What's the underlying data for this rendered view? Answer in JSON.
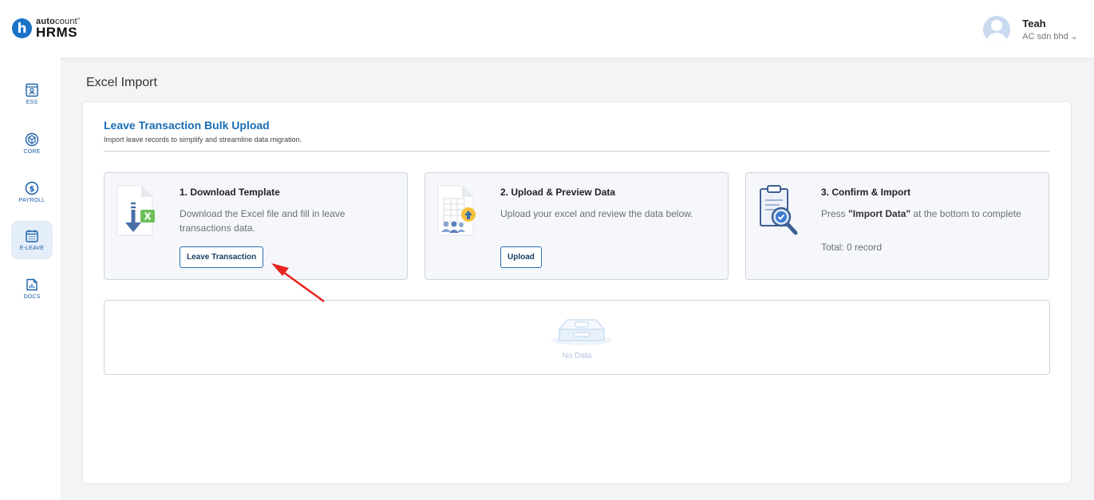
{
  "brand": {
    "initial": "h",
    "top_bold": "auto",
    "top_rest": "count",
    "mark": "°",
    "bottom": "HRMS"
  },
  "user": {
    "name": "Teah",
    "company": "AC sdn bhd",
    "chevron": "⌄"
  },
  "sidebar": {
    "items": [
      {
        "label": "ESS",
        "icon": "ess-icon",
        "active": false
      },
      {
        "label": "CORE",
        "icon": "core-icon",
        "active": false
      },
      {
        "label": "PAYROLL",
        "icon": "payroll-icon",
        "active": false
      },
      {
        "label": "E-LEAVE",
        "icon": "calendar-icon",
        "active": true
      },
      {
        "label": "DOCS",
        "icon": "docs-icon",
        "active": false
      }
    ]
  },
  "page": {
    "title": "Excel Import"
  },
  "section": {
    "title": "Leave Transaction Bulk Upload",
    "subtitle": "Import leave records to simplify and streamline data migration."
  },
  "steps": [
    {
      "title": "1. Download Template",
      "description": "Download the Excel file and fill in leave transactions data.",
      "button": "Leave Transaction",
      "icon": "excel-download-icon"
    },
    {
      "title": "2. Upload & Preview Data",
      "description": "Upload your excel and review the data below.",
      "button": "Upload",
      "icon": "upload-file-icon"
    },
    {
      "title": "3. Confirm & Import",
      "description_pre": "Press ",
      "description_bold": "\"Import Data\"",
      "description_post": " at the bottom to complete",
      "total": "Total: 0 record",
      "icon": "clipboard-check-icon"
    }
  ],
  "table": {
    "empty_text": "No Data",
    "icon": "empty-box-icon"
  },
  "colors": {
    "accent": "#1a6db5",
    "arrow": "#e8231f",
    "active_nav": "#e4eefa"
  }
}
